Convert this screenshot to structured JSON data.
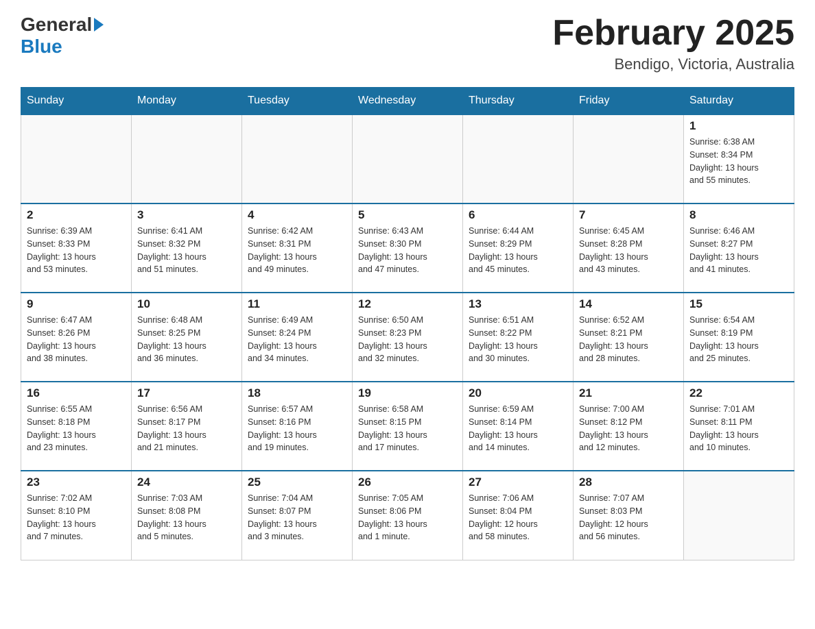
{
  "header": {
    "logo_general": "General",
    "logo_blue": "Blue",
    "month_title": "February 2025",
    "location": "Bendigo, Victoria, Australia"
  },
  "days_of_week": [
    "Sunday",
    "Monday",
    "Tuesday",
    "Wednesday",
    "Thursday",
    "Friday",
    "Saturday"
  ],
  "weeks": [
    [
      {
        "day": "",
        "info": ""
      },
      {
        "day": "",
        "info": ""
      },
      {
        "day": "",
        "info": ""
      },
      {
        "day": "",
        "info": ""
      },
      {
        "day": "",
        "info": ""
      },
      {
        "day": "",
        "info": ""
      },
      {
        "day": "1",
        "info": "Sunrise: 6:38 AM\nSunset: 8:34 PM\nDaylight: 13 hours\nand 55 minutes."
      }
    ],
    [
      {
        "day": "2",
        "info": "Sunrise: 6:39 AM\nSunset: 8:33 PM\nDaylight: 13 hours\nand 53 minutes."
      },
      {
        "day": "3",
        "info": "Sunrise: 6:41 AM\nSunset: 8:32 PM\nDaylight: 13 hours\nand 51 minutes."
      },
      {
        "day": "4",
        "info": "Sunrise: 6:42 AM\nSunset: 8:31 PM\nDaylight: 13 hours\nand 49 minutes."
      },
      {
        "day": "5",
        "info": "Sunrise: 6:43 AM\nSunset: 8:30 PM\nDaylight: 13 hours\nand 47 minutes."
      },
      {
        "day": "6",
        "info": "Sunrise: 6:44 AM\nSunset: 8:29 PM\nDaylight: 13 hours\nand 45 minutes."
      },
      {
        "day": "7",
        "info": "Sunrise: 6:45 AM\nSunset: 8:28 PM\nDaylight: 13 hours\nand 43 minutes."
      },
      {
        "day": "8",
        "info": "Sunrise: 6:46 AM\nSunset: 8:27 PM\nDaylight: 13 hours\nand 41 minutes."
      }
    ],
    [
      {
        "day": "9",
        "info": "Sunrise: 6:47 AM\nSunset: 8:26 PM\nDaylight: 13 hours\nand 38 minutes."
      },
      {
        "day": "10",
        "info": "Sunrise: 6:48 AM\nSunset: 8:25 PM\nDaylight: 13 hours\nand 36 minutes."
      },
      {
        "day": "11",
        "info": "Sunrise: 6:49 AM\nSunset: 8:24 PM\nDaylight: 13 hours\nand 34 minutes."
      },
      {
        "day": "12",
        "info": "Sunrise: 6:50 AM\nSunset: 8:23 PM\nDaylight: 13 hours\nand 32 minutes."
      },
      {
        "day": "13",
        "info": "Sunrise: 6:51 AM\nSunset: 8:22 PM\nDaylight: 13 hours\nand 30 minutes."
      },
      {
        "day": "14",
        "info": "Sunrise: 6:52 AM\nSunset: 8:21 PM\nDaylight: 13 hours\nand 28 minutes."
      },
      {
        "day": "15",
        "info": "Sunrise: 6:54 AM\nSunset: 8:19 PM\nDaylight: 13 hours\nand 25 minutes."
      }
    ],
    [
      {
        "day": "16",
        "info": "Sunrise: 6:55 AM\nSunset: 8:18 PM\nDaylight: 13 hours\nand 23 minutes."
      },
      {
        "day": "17",
        "info": "Sunrise: 6:56 AM\nSunset: 8:17 PM\nDaylight: 13 hours\nand 21 minutes."
      },
      {
        "day": "18",
        "info": "Sunrise: 6:57 AM\nSunset: 8:16 PM\nDaylight: 13 hours\nand 19 minutes."
      },
      {
        "day": "19",
        "info": "Sunrise: 6:58 AM\nSunset: 8:15 PM\nDaylight: 13 hours\nand 17 minutes."
      },
      {
        "day": "20",
        "info": "Sunrise: 6:59 AM\nSunset: 8:14 PM\nDaylight: 13 hours\nand 14 minutes."
      },
      {
        "day": "21",
        "info": "Sunrise: 7:00 AM\nSunset: 8:12 PM\nDaylight: 13 hours\nand 12 minutes."
      },
      {
        "day": "22",
        "info": "Sunrise: 7:01 AM\nSunset: 8:11 PM\nDaylight: 13 hours\nand 10 minutes."
      }
    ],
    [
      {
        "day": "23",
        "info": "Sunrise: 7:02 AM\nSunset: 8:10 PM\nDaylight: 13 hours\nand 7 minutes."
      },
      {
        "day": "24",
        "info": "Sunrise: 7:03 AM\nSunset: 8:08 PM\nDaylight: 13 hours\nand 5 minutes."
      },
      {
        "day": "25",
        "info": "Sunrise: 7:04 AM\nSunset: 8:07 PM\nDaylight: 13 hours\nand 3 minutes."
      },
      {
        "day": "26",
        "info": "Sunrise: 7:05 AM\nSunset: 8:06 PM\nDaylight: 13 hours\nand 1 minute."
      },
      {
        "day": "27",
        "info": "Sunrise: 7:06 AM\nSunset: 8:04 PM\nDaylight: 12 hours\nand 58 minutes."
      },
      {
        "day": "28",
        "info": "Sunrise: 7:07 AM\nSunset: 8:03 PM\nDaylight: 12 hours\nand 56 minutes."
      },
      {
        "day": "",
        "info": ""
      }
    ]
  ]
}
